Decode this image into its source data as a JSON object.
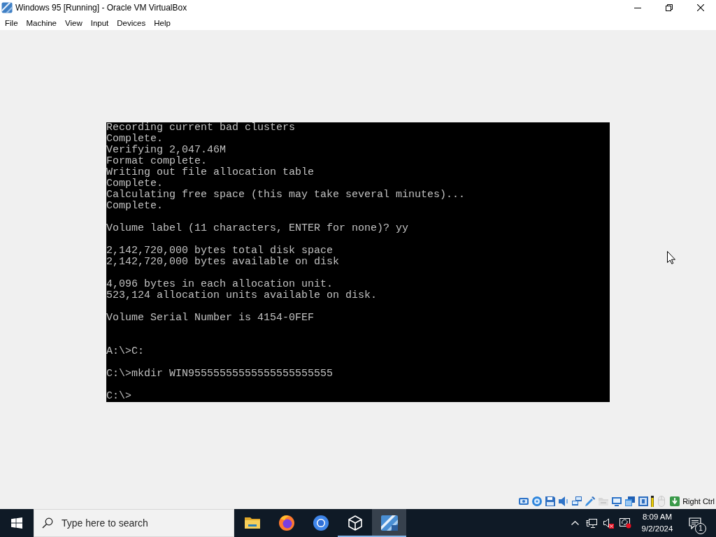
{
  "window": {
    "title": "Windows 95 [Running] - Oracle VM VirtualBox"
  },
  "menu": [
    "File",
    "Machine",
    "View",
    "Input",
    "Devices",
    "Help"
  ],
  "vm_screen": {
    "lines": [
      {
        "kind": "text",
        "text": "Recording current bad clusters"
      },
      {
        "kind": "text",
        "text": "Complete."
      },
      {
        "kind": "text",
        "text": "Verifying 2,047.46M"
      },
      {
        "kind": "text",
        "text": "Format complete."
      },
      {
        "kind": "text",
        "text": "Writing out file allocation table"
      },
      {
        "kind": "text",
        "text": "Complete."
      },
      {
        "kind": "text",
        "text": "Calculating free space (this may take several minutes)..."
      },
      {
        "kind": "text",
        "text": "Complete."
      },
      {
        "kind": "blank"
      },
      {
        "kind": "text",
        "text": "Volume label (11 characters, ENTER for none)? yy"
      },
      {
        "kind": "blank"
      },
      {
        "kind": "text",
        "text": "2,142,720,000 bytes total disk space"
      },
      {
        "kind": "text",
        "text": "2,142,720,000 bytes available on disk"
      },
      {
        "kind": "blank"
      },
      {
        "kind": "text",
        "text": "        4,096 bytes in each allocation unit."
      },
      {
        "kind": "text",
        "text": "      523,124 allocation units available on disk."
      },
      {
        "kind": "blank"
      },
      {
        "kind": "text",
        "text": "Volume Serial Number is 4154-0FEF"
      },
      {
        "kind": "blank"
      },
      {
        "kind": "blank"
      },
      {
        "kind": "text",
        "text": "A:\\>C:"
      },
      {
        "kind": "blank"
      },
      {
        "kind": "text",
        "text": "C:\\>mkdir WIN95555555555555555555555"
      },
      {
        "kind": "blank"
      },
      {
        "kind": "text",
        "text": "C:\\>"
      }
    ]
  },
  "status_bar": {
    "indicators": [
      {
        "kind": "harddisk",
        "disabled": false
      },
      {
        "kind": "optical",
        "disabled": false
      },
      {
        "kind": "floppy",
        "disabled": false
      },
      {
        "kind": "audio",
        "disabled": false
      },
      {
        "kind": "network",
        "disabled": false
      },
      {
        "kind": "usb",
        "disabled": false
      },
      {
        "kind": "sharedfolders",
        "disabled": true
      },
      {
        "kind": "display",
        "disabled": false
      },
      {
        "kind": "recording",
        "disabled": false
      },
      {
        "kind": "features",
        "disabled": false
      },
      {
        "kind": "cpu",
        "disabled": false
      },
      {
        "kind": "mouse",
        "disabled": true
      },
      {
        "kind": "keyboard",
        "disabled": false
      }
    ],
    "host_key": "Right Ctrl"
  },
  "taskbar": {
    "search": {
      "placeholder": "Type here to search"
    },
    "apps": [
      {
        "kind": "explorer",
        "running": false,
        "selected": false
      },
      {
        "kind": "firefox",
        "running": false,
        "selected": false
      },
      {
        "kind": "chromium",
        "running": false,
        "selected": false
      },
      {
        "kind": "virtualbox",
        "running": true,
        "selected": false
      },
      {
        "kind": "vm",
        "running": true,
        "selected": true
      }
    ],
    "tray": {
      "icons": [
        {
          "kind": "chevron"
        },
        {
          "kind": "network"
        },
        {
          "kind": "volume",
          "muted": true
        },
        {
          "kind": "display",
          "alert": true
        }
      ],
      "time": "8:09 AM",
      "date": "9/2/2024",
      "notification_count": "1"
    }
  }
}
